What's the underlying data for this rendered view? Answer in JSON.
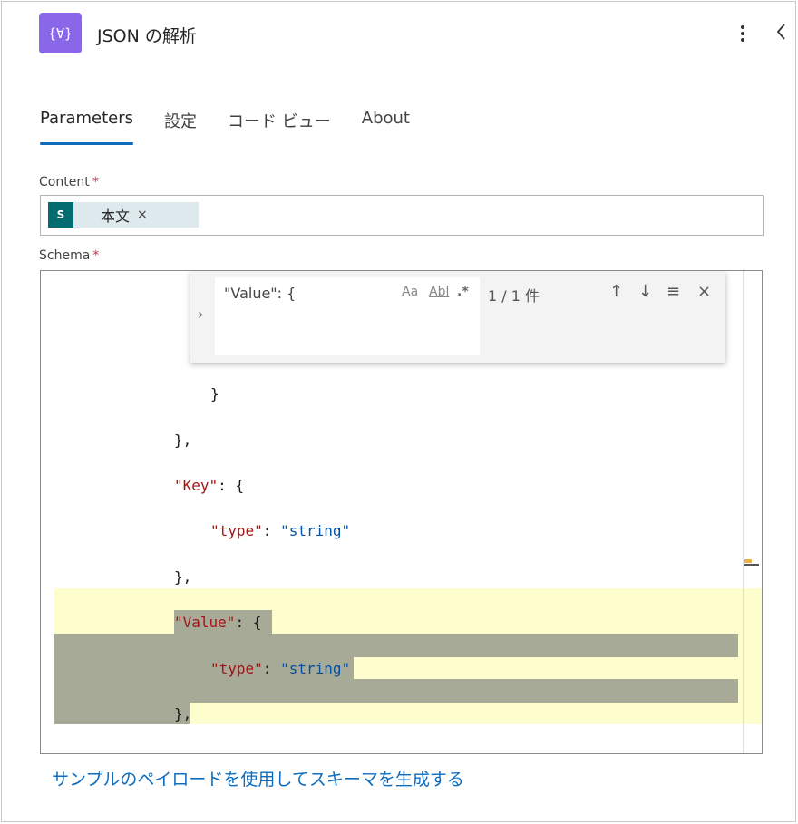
{
  "header": {
    "icon_text": "{∀}",
    "title": "JSON の解析"
  },
  "tabs": [
    {
      "label": "Parameters",
      "active": true
    },
    {
      "label": "設定",
      "active": false
    },
    {
      "label": "コード ビュー",
      "active": false
    },
    {
      "label": "About",
      "active": false
    }
  ],
  "content_field": {
    "label": "Content",
    "required_mark": "*",
    "token": {
      "icon_text": "S",
      "label": "本文",
      "remove": "×"
    }
  },
  "schema_field": {
    "label": "Schema",
    "required_mark": "*",
    "find_widget": {
      "query": "\"Value\": {",
      "match_case": "Aa",
      "whole_word": "Abl",
      "regex": ".*",
      "count": "1 / 1 件",
      "prev": "↑",
      "next": "↓",
      "in_selection": "≡",
      "close": "×",
      "toggle": "›"
    },
    "code_lines": [
      "}",
      "},",
      "\"Key\": {",
      "\"type\": \"string\"",
      "},",
      "\"Value\": {",
      "\"type\": \"string\"",
      "},"
    ]
  },
  "generate_link": "サンプルのペイロードを使用してスキーマを生成する"
}
